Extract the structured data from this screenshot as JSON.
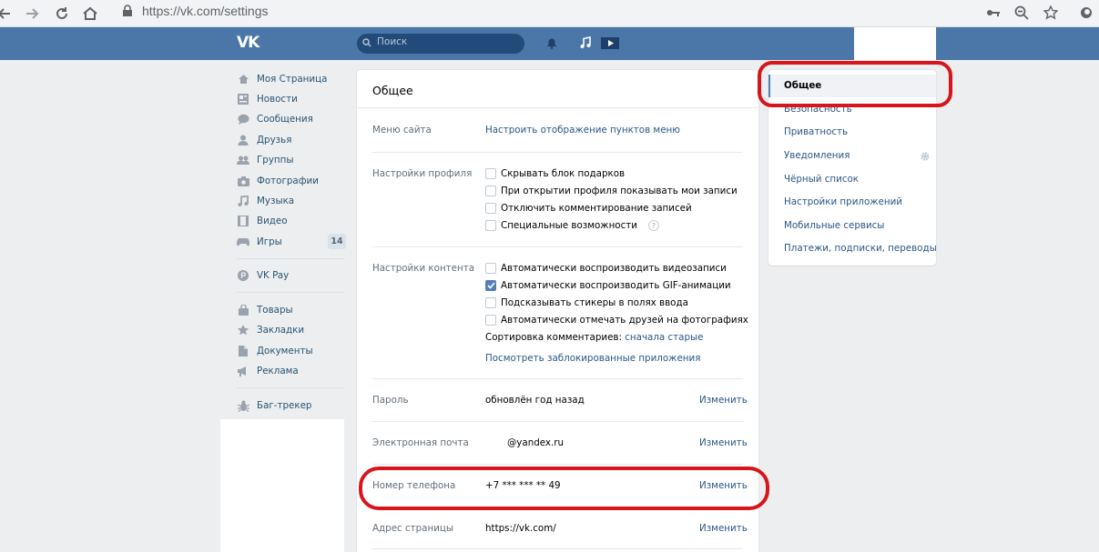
{
  "browser": {
    "url": "https://vk.com/settings",
    "back_icon": "arrow-left-icon",
    "forward_icon": "arrow-right-icon",
    "reload_icon": "reload-icon",
    "home_icon": "home-icon"
  },
  "header": {
    "logo": "VK",
    "search_placeholder": "Поиск"
  },
  "left_menu": {
    "items": [
      {
        "label": "Моя Страница",
        "icon": "home-icon"
      },
      {
        "label": "Новости",
        "icon": "news-icon"
      },
      {
        "label": "Сообщения",
        "icon": "message-icon"
      },
      {
        "label": "Друзья",
        "icon": "user-icon"
      },
      {
        "label": "Группы",
        "icon": "users-icon"
      },
      {
        "label": "Фотографии",
        "icon": "camera-icon"
      },
      {
        "label": "Музыка",
        "icon": "music-icon"
      },
      {
        "label": "Видео",
        "icon": "video-icon"
      },
      {
        "label": "Игры",
        "icon": "gamepad-icon",
        "badge": "14"
      },
      {
        "label": "VK Pay",
        "icon": "vkpay-icon"
      },
      {
        "label": "Товары",
        "icon": "bag-icon"
      },
      {
        "label": "Закладки",
        "icon": "star-icon"
      },
      {
        "label": "Документы",
        "icon": "document-icon"
      },
      {
        "label": "Реклама",
        "icon": "megaphone-icon"
      },
      {
        "label": "Баг-трекер",
        "icon": "bug-icon"
      }
    ]
  },
  "main": {
    "title": "Общее",
    "site_menu": {
      "label": "Меню сайта",
      "link": "Настроить отображение пунктов меню"
    },
    "profile": {
      "label": "Настройки профиля",
      "options": [
        {
          "label": "Скрывать блок подарков",
          "checked": false
        },
        {
          "label": "При открытии профиля показывать мои записи",
          "checked": false
        },
        {
          "label": "Отключить комментирование записей",
          "checked": false
        },
        {
          "label": "Специальные возможности",
          "checked": false
        }
      ],
      "help": "?"
    },
    "content": {
      "label": "Настройки контента",
      "options": [
        {
          "label": "Автоматически воспроизводить видеозаписи",
          "checked": false
        },
        {
          "label": "Автоматически воспроизводить GIF-анимации",
          "checked": true
        },
        {
          "label": "Подсказывать стикеры в полях ввода",
          "checked": false
        },
        {
          "label": "Автоматически отмечать друзей на фотографиях",
          "checked": false
        }
      ],
      "sort_label": "Сортировка комментариев:",
      "sort_value": "сначала старые",
      "blocked_apps_link": "Посмотреть заблокированные приложения"
    },
    "password": {
      "label": "Пароль",
      "value": "обновлён год назад",
      "action": "Изменить"
    },
    "email": {
      "label": "Электронная почта",
      "value": "@yandex.ru",
      "action": "Изменить"
    },
    "phone": {
      "label": "Номер телефона",
      "value": "+7 *** *** ** 49",
      "action": "Изменить"
    },
    "address": {
      "label": "Адрес страницы",
      "value": "https://vk.com/",
      "action": "Изменить"
    }
  },
  "right_menu": {
    "items": [
      {
        "label": "Общее",
        "active": true
      },
      {
        "label": "Безопасность"
      },
      {
        "label": "Приватность"
      },
      {
        "label": "Уведомления",
        "icon": "gear-icon"
      },
      {
        "label": "Чёрный список"
      },
      {
        "label": "Настройки приложений"
      },
      {
        "label": "Мобильные сервисы"
      },
      {
        "label": "Платежи, подписки, переводы"
      }
    ]
  },
  "colors": {
    "header": "#4a76a8",
    "link": "#2a5885",
    "annotation": "#d7151b"
  }
}
